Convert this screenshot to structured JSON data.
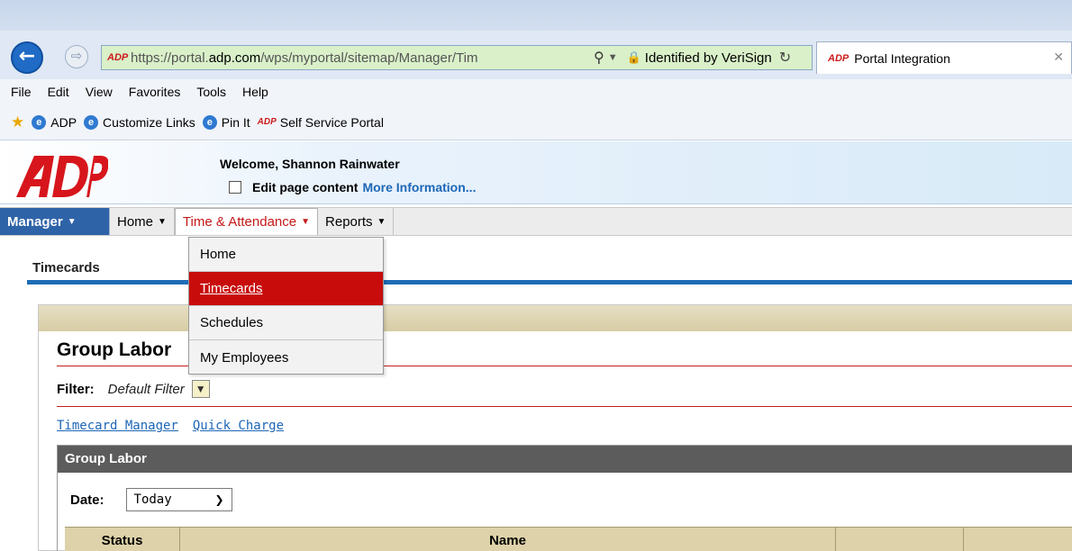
{
  "browser": {
    "url_prefix": "https://portal.",
    "url_domain": "adp.com",
    "url_path": "/wps/myportal/sitemap/Manager/Tim",
    "identity": "Identified by VeriSign",
    "tab_title": "Portal Integration",
    "menu": [
      "File",
      "Edit",
      "View",
      "Favorites",
      "Tools",
      "Help"
    ],
    "favorites": [
      "ADP",
      "Customize Links",
      "Pin It",
      "Self Service Portal"
    ]
  },
  "header": {
    "welcome": "Welcome, Shannon Rainwater",
    "edit_label": "Edit page content",
    "more_info": "More Information..."
  },
  "nav": {
    "manager": "Manager",
    "items": [
      "Home",
      "Time & Attendance",
      "Reports"
    ]
  },
  "dropdown": {
    "items": [
      "Home",
      "Timecards",
      "Schedules",
      "My Employees"
    ],
    "selected": "Timecards"
  },
  "page": {
    "breadcrumb_title": "Timecards",
    "group_heading": "Group Labor",
    "filter_label": "Filter:",
    "filter_value": "Default Filter",
    "links": [
      "Timecard Manager",
      "Quick Charge"
    ],
    "grid_title": "Group Labor",
    "date_label": "Date:",
    "date_value": "Today",
    "columns": [
      "Status",
      "Name"
    ]
  },
  "colors": {
    "nav_manager_bg": "#2f63a8",
    "dropdown_selected_bg": "#c80c0c",
    "link": "#1d66b6",
    "accent_blue_rule": "#1e6cb5"
  }
}
